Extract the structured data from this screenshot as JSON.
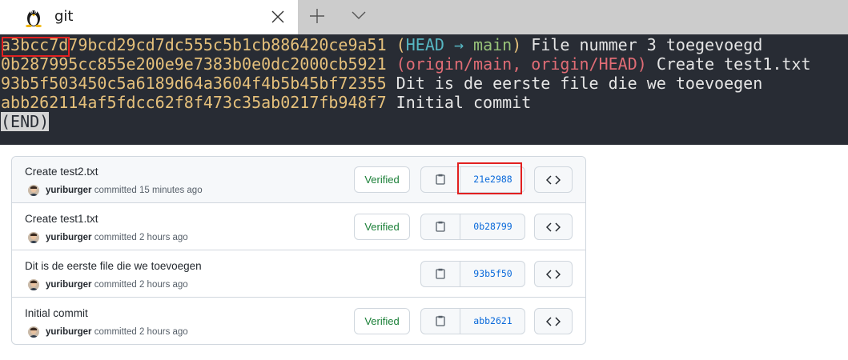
{
  "tab": {
    "title": "git",
    "icon": "linux-penguin-icon",
    "close_icon": "close-icon",
    "add_icon": "plus-icon",
    "dropdown_icon": "chevron-down-icon"
  },
  "terminal": {
    "lines": [
      {
        "hash": "a3bcc7d79bcd29cd7dc555c5b1cb886420ce9a51",
        "open": " (",
        "head": "HEAD",
        "arrow": " → ",
        "branch": "main",
        "close": ")",
        "message": " File nummer 3 toegevoegd"
      },
      {
        "hash": "0b287995cc855e200e9e7383b0e0dc2000cb5921",
        "open": " (",
        "remote1": "origin/main",
        "comma": ", ",
        "remote2": "origin/HEAD",
        "close": ")",
        "message": " Create test1.txt"
      },
      {
        "hash": "93b5f503450c5a6189d64a3604f4b5b45bf72355",
        "message": " Dit is de eerste file die we toevoegen"
      },
      {
        "hash": "abb262114af5fdcc62f8f473c35ab0217fb948f7",
        "message": " Initial commit"
      }
    ],
    "end_marker": "(END)",
    "colors": {
      "background": "#282c34",
      "hash": "#e5c07b",
      "head": "#56b6c2",
      "branch": "#98c379",
      "remote": "#e06c75"
    }
  },
  "commits": [
    {
      "title": "Create test2.txt",
      "author": "yuriburger",
      "time": "committed 15 minutes ago",
      "verified": "Verified",
      "sha": "21e2988"
    },
    {
      "title": "Create test1.txt",
      "author": "yuriburger",
      "time": "committed 2 hours ago",
      "verified": "Verified",
      "sha": "0b28799"
    },
    {
      "title": "Dit is de eerste file die we toevoegen",
      "author": "yuriburger",
      "time": "committed 2 hours ago",
      "verified": "",
      "sha": "93b5f50"
    },
    {
      "title": "Initial commit",
      "author": "yuriburger",
      "time": "committed 2 hours ago",
      "verified": "Verified",
      "sha": "abb2621"
    }
  ],
  "icons": {
    "copy": "clipboard-icon",
    "browse": "code-icon",
    "avatar": "user-avatar"
  },
  "highlight_color": "#e22020"
}
